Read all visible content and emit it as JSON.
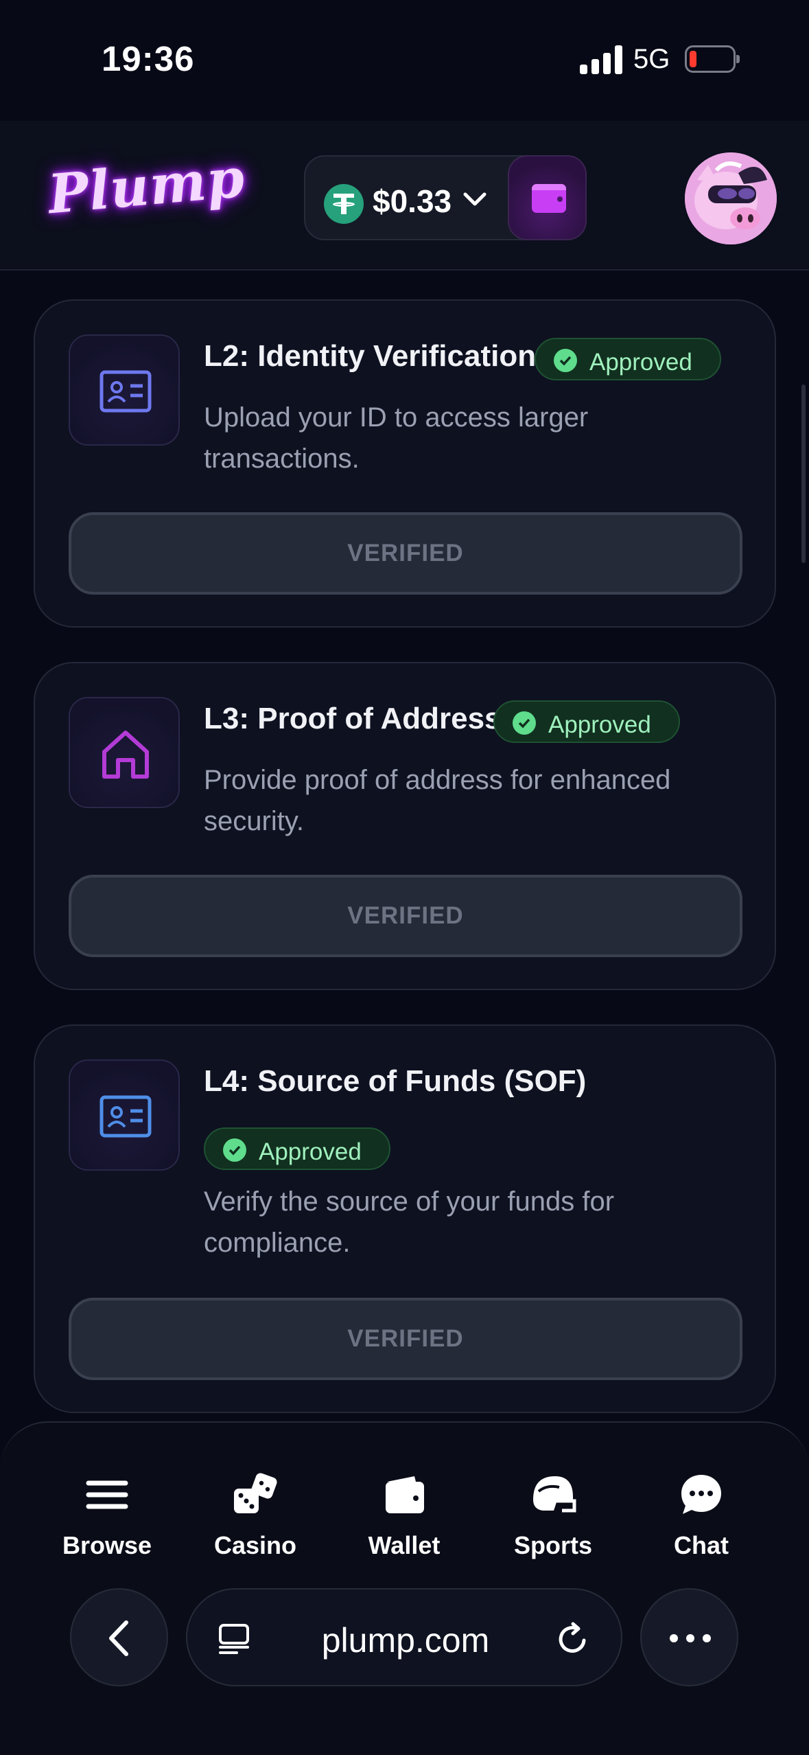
{
  "status_bar": {
    "time": "19:36",
    "network": "5G"
  },
  "header": {
    "logo": "Plump",
    "balance": "$0.33",
    "currency_icon": "tether-icon",
    "wallet_icon": "wallet-icon",
    "avatar_icon": "pig-avatar"
  },
  "cards": [
    {
      "title": "L2: Identity Verification",
      "status": "Approved",
      "description": "Upload your ID to access larger transactions.",
      "button": "VERIFIED",
      "icon": "id-card-icon",
      "icon_color": "#6e78ee"
    },
    {
      "title": "L3: Proof of Address",
      "status": "Approved",
      "description": "Provide proof of address for enhanced security.",
      "button": "VERIFIED",
      "icon": "home-icon",
      "icon_color": "#b33bd6"
    },
    {
      "title": "L4: Source of Funds (SOF)",
      "status": "Approved",
      "description": "Verify the source of your funds for compliance.",
      "button": "VERIFIED",
      "icon": "id-card-icon",
      "icon_color": "#4f8ee8"
    }
  ],
  "bottom_nav": [
    {
      "label": "Browse",
      "icon": "menu-icon"
    },
    {
      "label": "Casino",
      "icon": "dice-icon"
    },
    {
      "label": "Wallet",
      "icon": "wallet-icon"
    },
    {
      "label": "Sports",
      "icon": "helmet-icon"
    },
    {
      "label": "Chat",
      "icon": "chat-icon"
    }
  ],
  "browser": {
    "url": "plump.com"
  },
  "colors": {
    "background": "#070a16",
    "card_bg": "#0e1120",
    "approved_green": "#5fdc8c",
    "brand_purple": "#c83ef5"
  }
}
